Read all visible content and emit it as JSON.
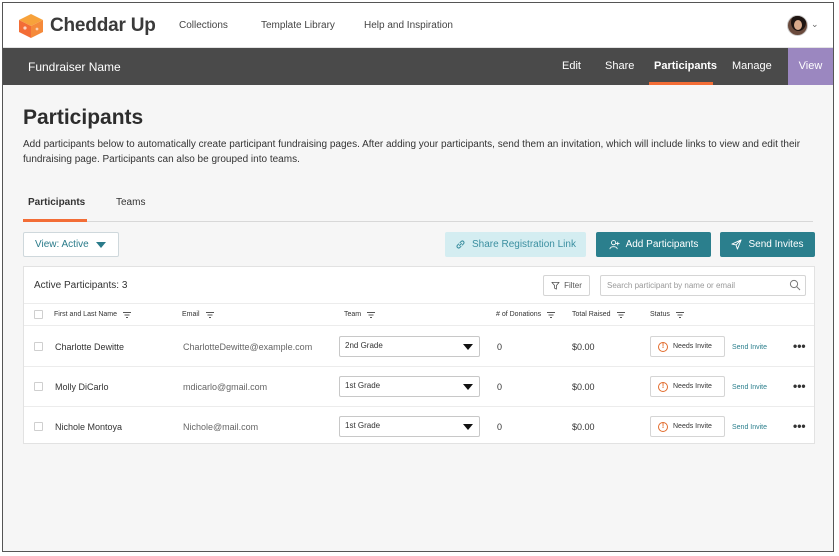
{
  "brand": {
    "name": "Cheddar Up",
    "accent": "#f36d36",
    "teal": "#2b7f8d",
    "purple": "#9b87c0"
  },
  "topnav": {
    "links": [
      "Collections",
      "Template Library",
      "Help and Inspiration"
    ],
    "avatar_icon": "user-avatar",
    "menu_icon": "chevron-down-icon"
  },
  "subbar": {
    "title": "Fundraiser Name",
    "tabs": [
      "Edit",
      "Share",
      "Participants",
      "Manage"
    ],
    "active_tab": "Participants",
    "view_label": "View"
  },
  "page": {
    "title": "Participants",
    "description": "Add participants below to automatically create participant fundraising pages. After adding your participants, send them an invitation, which will include links to view and edit their fundraising page. Participants can also be grouped into teams."
  },
  "tabs": {
    "items": [
      "Participants",
      "Teams"
    ],
    "active": "Participants"
  },
  "toolbar": {
    "view_select": "View: Active",
    "share_link": "Share Registration Link",
    "add_participants": "Add Participants",
    "send_invites": "Send Invites"
  },
  "table": {
    "title": "Active Participants: 3",
    "filter_label": "Filter",
    "search_placeholder": "Search participant by name or email",
    "columns": [
      "First and Last Name",
      "Email",
      "Team",
      "# of Donations",
      "Total Raised",
      "Status"
    ],
    "rows": [
      {
        "name": "Charlotte Dewitte",
        "email": "CharlotteDewitte@example.com",
        "team": "2nd Grade",
        "donations": "0",
        "raised": "$0.00",
        "status": "Needs Invite",
        "action": "Send Invite"
      },
      {
        "name": "Molly DiCarlo",
        "email": "mdicarlo@gmail.com",
        "team": "1st Grade",
        "donations": "0",
        "raised": "$0.00",
        "status": "Needs Invite",
        "action": "Send Invite"
      },
      {
        "name": "Nichole Montoya",
        "email": "Nichole@mail.com",
        "team": "1st Grade",
        "donations": "0",
        "raised": "$0.00",
        "status": "Needs Invite",
        "action": "Send Invite"
      }
    ]
  }
}
